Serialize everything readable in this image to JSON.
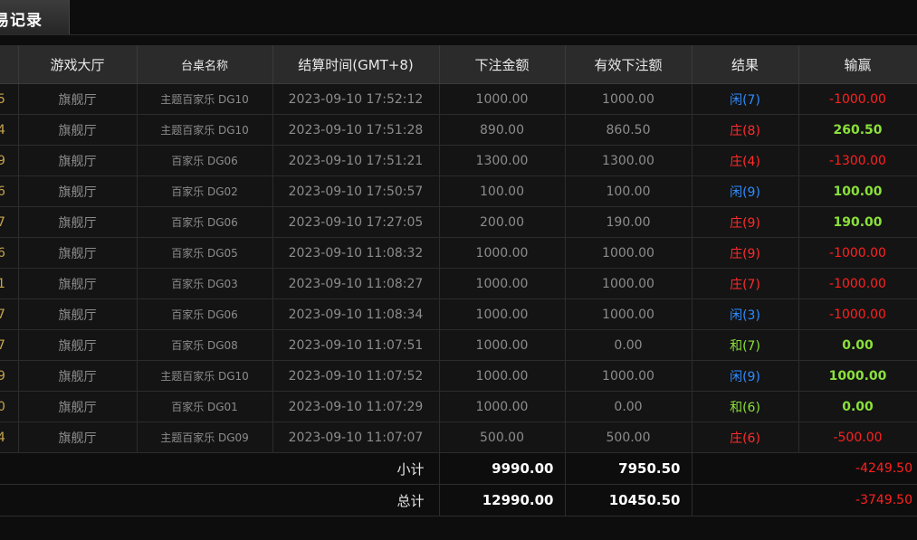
{
  "tab": {
    "title": "易记录"
  },
  "table": {
    "headers": {
      "idx": "",
      "hall": "游戏大厅",
      "table_name": "台桌名称",
      "settle_time": "结算时间(GMT+8)",
      "bet_amount": "下注金额",
      "valid_bet": "有效下注额",
      "result": "结果",
      "win_loss": "输赢"
    },
    "rows": [
      {
        "idx": "5",
        "hall": "旗舰厅",
        "table_name": "主题百家乐 DG10",
        "settle_time": "2023-09-10 17:52:12",
        "bet_amount": "1000.00",
        "valid_bet": "1000.00",
        "result": "闲(7)",
        "win_loss": "-1000.00"
      },
      {
        "idx": "4",
        "hall": "旗舰厅",
        "table_name": "主题百家乐 DG10",
        "settle_time": "2023-09-10 17:51:28",
        "bet_amount": "890.00",
        "valid_bet": "860.50",
        "result": "庄(8)",
        "win_loss": "260.50"
      },
      {
        "idx": "9",
        "hall": "旗舰厅",
        "table_name": "百家乐 DG06",
        "settle_time": "2023-09-10 17:51:21",
        "bet_amount": "1300.00",
        "valid_bet": "1300.00",
        "result": "庄(4)",
        "win_loss": "-1300.00"
      },
      {
        "idx": "6",
        "hall": "旗舰厅",
        "table_name": "百家乐 DG02",
        "settle_time": "2023-09-10 17:50:57",
        "bet_amount": "100.00",
        "valid_bet": "100.00",
        "result": "闲(9)",
        "win_loss": "100.00"
      },
      {
        "idx": "7",
        "hall": "旗舰厅",
        "table_name": "百家乐 DG06",
        "settle_time": "2023-09-10 17:27:05",
        "bet_amount": "200.00",
        "valid_bet": "190.00",
        "result": "庄(9)",
        "win_loss": "190.00"
      },
      {
        "idx": "6",
        "hall": "旗舰厅",
        "table_name": "百家乐 DG05",
        "settle_time": "2023-09-10 11:08:32",
        "bet_amount": "1000.00",
        "valid_bet": "1000.00",
        "result": "庄(9)",
        "win_loss": "-1000.00"
      },
      {
        "idx": "1",
        "hall": "旗舰厅",
        "table_name": "百家乐 DG03",
        "settle_time": "2023-09-10 11:08:27",
        "bet_amount": "1000.00",
        "valid_bet": "1000.00",
        "result": "庄(7)",
        "win_loss": "-1000.00"
      },
      {
        "idx": "7",
        "hall": "旗舰厅",
        "table_name": "百家乐 DG06",
        "settle_time": "2023-09-10 11:08:34",
        "bet_amount": "1000.00",
        "valid_bet": "1000.00",
        "result": "闲(3)",
        "win_loss": "-1000.00"
      },
      {
        "idx": "7",
        "hall": "旗舰厅",
        "table_name": "百家乐 DG08",
        "settle_time": "2023-09-10 11:07:51",
        "bet_amount": "1000.00",
        "valid_bet": "0.00",
        "result": "和(7)",
        "win_loss": "0.00"
      },
      {
        "idx": "9",
        "hall": "旗舰厅",
        "table_name": "主题百家乐 DG10",
        "settle_time": "2023-09-10 11:07:52",
        "bet_amount": "1000.00",
        "valid_bet": "1000.00",
        "result": "闲(9)",
        "win_loss": "1000.00"
      },
      {
        "idx": "0",
        "hall": "旗舰厅",
        "table_name": "百家乐 DG01",
        "settle_time": "2023-09-10 11:07:29",
        "bet_amount": "1000.00",
        "valid_bet": "0.00",
        "result": "和(6)",
        "win_loss": "0.00"
      },
      {
        "idx": "4",
        "hall": "旗舰厅",
        "table_name": "主题百家乐 DG09",
        "settle_time": "2023-09-10 11:07:07",
        "bet_amount": "500.00",
        "valid_bet": "500.00",
        "result": "庄(6)",
        "win_loss": "-500.00"
      }
    ],
    "subtotal": {
      "label": "小计",
      "bet_amount": "9990.00",
      "valid_bet": "7950.50",
      "win_loss": "-4249.50"
    },
    "total": {
      "label": "总计",
      "bet_amount": "12990.00",
      "valid_bet": "10450.50",
      "win_loss": "-3749.50"
    }
  },
  "colors": {
    "banker_red": "#ff2b2b",
    "player_blue": "#2e8cff",
    "tie_green": "#8ae03a",
    "loss_red": "#ff2020",
    "win_green": "#8ae03a"
  }
}
